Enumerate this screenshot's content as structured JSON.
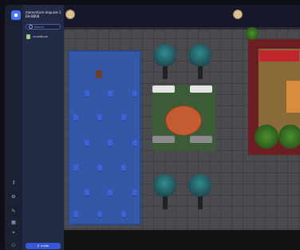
{
  "app": {
    "space_name": "momentum-impulse-1",
    "space_sub": "EH-8808"
  },
  "sidebar": {
    "search_placeholder": "Search",
    "members": [
      {
        "name": "ronaldtune"
      }
    ],
    "invite_label": "Invite"
  },
  "rail": {
    "icons": [
      "key-icon",
      "gear-icon",
      "pen-icon",
      "calendar-icon",
      "location-icon",
      "people-icon"
    ]
  },
  "colors": {
    "sidebar_bg": "#232a46",
    "rail_bg": "#1b2033",
    "accent": "#3558d8",
    "carpet": "#3457a8",
    "lounge_green": "#3b5c36",
    "table": "#c45c32"
  }
}
